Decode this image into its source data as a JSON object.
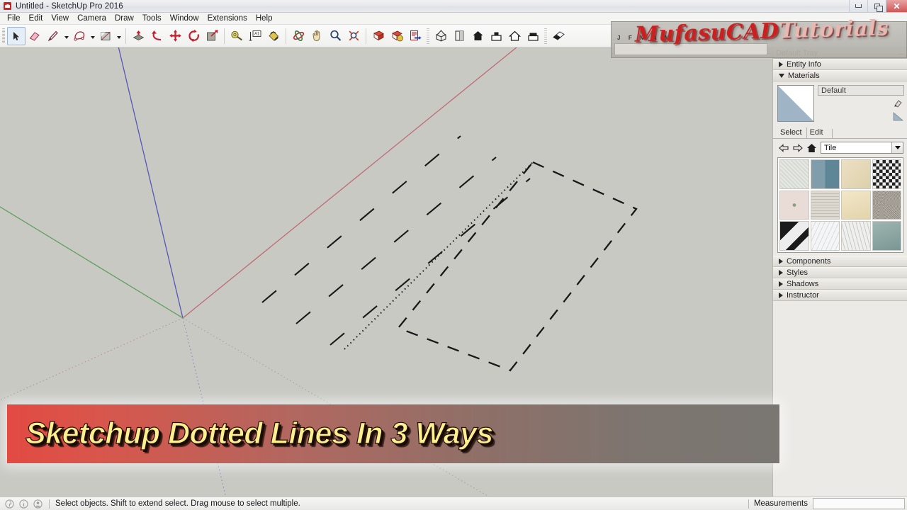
{
  "window": {
    "title": "Untitled - SketchUp Pro 2016",
    "app_icon": "sketchup-icon",
    "controls": [
      {
        "name": "minimize-button",
        "glyph": "minimize"
      },
      {
        "name": "restore-button",
        "glyph": "restore"
      },
      {
        "name": "close-button",
        "glyph": "✕"
      }
    ]
  },
  "menubar": {
    "items": [
      {
        "label": "File"
      },
      {
        "label": "Edit"
      },
      {
        "label": "View"
      },
      {
        "label": "Camera"
      },
      {
        "label": "Draw"
      },
      {
        "label": "Tools"
      },
      {
        "label": "Window"
      },
      {
        "label": "Extensions"
      },
      {
        "label": "Help"
      }
    ]
  },
  "toolbar": {
    "tools": [
      {
        "name": "select-tool",
        "icon": "arrow-cursor-icon",
        "selected": true
      },
      {
        "name": "eraser-tool",
        "icon": "eraser-icon",
        "selected": false
      },
      {
        "name": "line-tool",
        "icon": "pencil-icon",
        "selected": false,
        "dropdown": true
      },
      {
        "name": "arc-tool",
        "icon": "arc-icon",
        "selected": false,
        "dropdown": true
      },
      {
        "name": "rectangle-tool",
        "icon": "rectangle-icon",
        "selected": false,
        "dropdown": true
      },
      {
        "name": "pushpull-tool",
        "icon": "push-pull-icon",
        "selected": false
      },
      {
        "name": "followme-tool",
        "icon": "follow-me-icon",
        "selected": false
      },
      {
        "name": "move-tool",
        "icon": "move-arrows-icon",
        "selected": false
      },
      {
        "name": "rotate-tool",
        "icon": "rotate-icon",
        "selected": false
      },
      {
        "name": "scale-tool",
        "icon": "scale-icon",
        "selected": false
      },
      {
        "name": "tape-measure-tool",
        "icon": "tape-measure-icon",
        "selected": false
      },
      {
        "name": "dimension-tool",
        "icon": "dimension-icon",
        "selected": false
      },
      {
        "name": "paint-bucket-tool",
        "icon": "paint-bucket-icon",
        "selected": false
      },
      {
        "name": "orbit-tool",
        "icon": "orbit-icon",
        "selected": false
      },
      {
        "name": "pan-tool",
        "icon": "hand-icon",
        "selected": false
      },
      {
        "name": "zoom-tool",
        "icon": "magnifier-icon",
        "selected": false
      },
      {
        "name": "zoom-extents-tool",
        "icon": "zoom-extents-icon",
        "selected": false
      },
      {
        "name": "previous-view-button",
        "icon": "previous-view-icon",
        "selected": false
      },
      {
        "name": "next-view-button",
        "icon": "next-view-icon",
        "selected": false
      },
      {
        "name": "send-to-layout-button",
        "icon": "send-to-layout-icon",
        "selected": false
      },
      {
        "name": "view-iso-button",
        "icon": "iso-view-icon",
        "selected": false
      },
      {
        "name": "view-top-button",
        "icon": "top-view-icon",
        "selected": false
      },
      {
        "name": "view-front-button",
        "icon": "front-view-icon",
        "selected": false
      },
      {
        "name": "view-right-button",
        "icon": "right-view-icon",
        "selected": false
      },
      {
        "name": "view-back-button",
        "icon": "back-view-icon",
        "selected": false
      },
      {
        "name": "view-left-button",
        "icon": "left-view-icon",
        "selected": false
      },
      {
        "name": "style-shaded-button",
        "icon": "shaded-style-icon",
        "selected": false
      }
    ]
  },
  "canvas": {
    "background_color": "#c9c9c4",
    "axes": {
      "origin": [
        258,
        382
      ],
      "red_axis_color": "#bf6a72",
      "green_axis_color": "#5f9f5f",
      "blue_axis_color": "#5457b5"
    },
    "geometry_note": "Three dashed-line styles demonstrated: long dashes, fine dots, and a dashed rectangle outline"
  },
  "tray": {
    "title": "Default Tray",
    "pin_icon": "pin-icon",
    "sections": [
      {
        "label": "Entity Info",
        "expanded": false
      },
      {
        "label": "Materials",
        "expanded": true
      },
      {
        "label": "Components",
        "expanded": false
      },
      {
        "label": "Styles",
        "expanded": false
      },
      {
        "label": "Shadows",
        "expanded": false
      },
      {
        "label": "Instructor",
        "expanded": false
      }
    ],
    "materials": {
      "material_name": "Default",
      "name_placeholder": "Default",
      "sample_paint_icon": "sample-paint-icon",
      "tabs": [
        {
          "label": "Select",
          "active": true
        },
        {
          "label": "Edit",
          "active": false
        }
      ],
      "nav": {
        "back_icon": "arrow-left-icon",
        "forward_icon": "arrow-right-icon",
        "home_icon": "home-icon"
      },
      "library": "Tile",
      "library_options": [
        "Tile"
      ],
      "swatches": [
        {
          "name": "tile-speckled-white",
          "colors": [
            "#e4e6e1",
            "#d2d6cf"
          ]
        },
        {
          "name": "tile-blue-slate",
          "colors": [
            "#7b99a6",
            "#5d8494"
          ]
        },
        {
          "name": "tile-cream-stone",
          "colors": [
            "#e8dcc0",
            "#ddd0ae"
          ]
        },
        {
          "name": "tile-black-white-pattern",
          "colors": [
            "#2c2c2c",
            "#f0f0f0"
          ]
        },
        {
          "name": "tile-pink-floral",
          "colors": [
            "#e8d8d2",
            "#cdbab4"
          ]
        },
        {
          "name": "tile-stone-mosaic",
          "colors": [
            "#ded9d1",
            "#c4bdb1"
          ]
        },
        {
          "name": "tile-beige-ceramic",
          "colors": [
            "#f0e4c5",
            "#e4d5ae"
          ]
        },
        {
          "name": "tile-granite-grey",
          "colors": [
            "#b5b0a9",
            "#908a82"
          ]
        },
        {
          "name": "tile-black-blocks",
          "colors": [
            "#1c1c1c",
            "#e8e8e8"
          ]
        },
        {
          "name": "tile-white-marble",
          "colors": [
            "#f2f3f5",
            "#d8dade"
          ]
        },
        {
          "name": "tile-grey-marble",
          "colors": [
            "#ececea",
            "#c9c9c6"
          ]
        },
        {
          "name": "tile-teal-slate",
          "colors": [
            "#8fa9a6",
            "#7a9693"
          ]
        }
      ]
    }
  },
  "statusbar": {
    "icons": [
      {
        "name": "geo-location-icon"
      },
      {
        "name": "info-icon"
      },
      {
        "name": "account-icon"
      }
    ],
    "message": "Select objects. Shift to extend select. Drag mouse to select multiple.",
    "measurements_label": "Measurements",
    "measurements_value": ""
  },
  "overlays": {
    "watermark": {
      "text_dark": "MufasuCAD ",
      "text_light": "Tutorials",
      "color": "#cc2020"
    },
    "scene_bar_months": "J F M A M J",
    "banner": {
      "text": "Sketchup Dotted Lines In 3 Ways",
      "text_color": "#ffef8f",
      "accent_color": "#e24a42"
    }
  }
}
